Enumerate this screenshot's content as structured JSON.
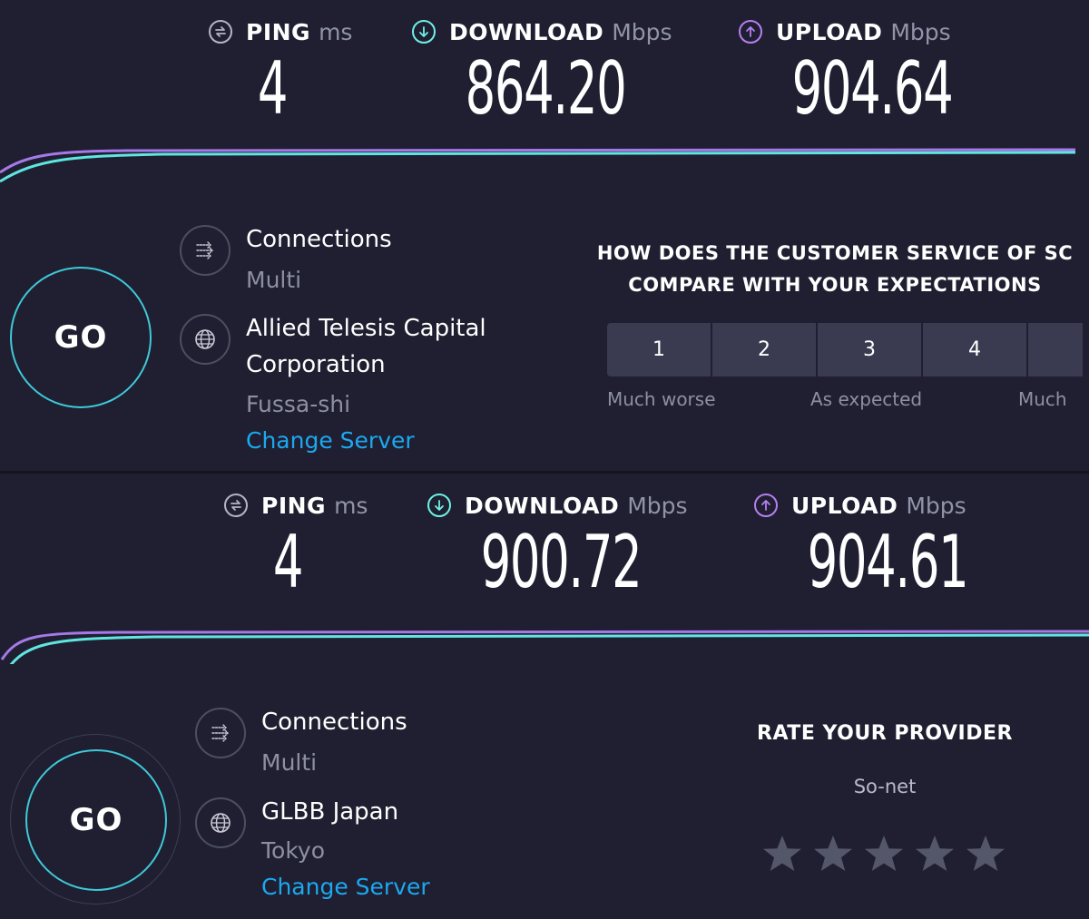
{
  "colors": {
    "background": "#1f1f31",
    "ping_icon": "#b4b4c4",
    "download_accent": "#6ff1e6",
    "upload_accent": "#b57ff0",
    "link": "#1ca8f0",
    "go_ring": "#3fc9d8"
  },
  "results": [
    {
      "ping": {
        "label": "PING",
        "unit": "ms",
        "value": "4",
        "icon": "ping-icon"
      },
      "download": {
        "label": "DOWNLOAD",
        "unit": "Mbps",
        "value": "864.20",
        "icon": "download-arrow-icon"
      },
      "upload": {
        "label": "UPLOAD",
        "unit": "Mbps",
        "value": "904.64",
        "icon": "upload-arrow-icon"
      },
      "go_label": "GO",
      "connections": {
        "title": "Connections",
        "value": "Multi",
        "icon": "connections-icon"
      },
      "server": {
        "title_line1": "Allied Telesis Capital",
        "title_line2": "Corporation",
        "location": "Fussa-shi",
        "icon": "globe-icon"
      },
      "change_server": "Change Server"
    },
    {
      "ping": {
        "label": "PING",
        "unit": "ms",
        "value": "4",
        "icon": "ping-icon"
      },
      "download": {
        "label": "DOWNLOAD",
        "unit": "Mbps",
        "value": "900.72",
        "icon": "download-arrow-icon"
      },
      "upload": {
        "label": "UPLOAD",
        "unit": "Mbps",
        "value": "904.61",
        "icon": "upload-arrow-icon"
      },
      "go_label": "GO",
      "connections": {
        "title": "Connections",
        "value": "Multi",
        "icon": "connections-icon"
      },
      "server": {
        "title_line1": "GLBB Japan",
        "location": "Tokyo",
        "icon": "globe-icon"
      },
      "change_server": "Change Server"
    }
  ],
  "survey": {
    "question_line1": "HOW DOES THE CUSTOMER SERVICE OF SC",
    "question_line2": "COMPARE WITH YOUR EXPECTATIONS",
    "options": [
      "1",
      "2",
      "3",
      "4",
      ""
    ],
    "caption_left": "Much worse",
    "caption_middle": "As expected",
    "caption_right": "Much"
  },
  "rating": {
    "title": "RATE YOUR PROVIDER",
    "provider": "So-net",
    "star_count": 5,
    "rating": 0
  }
}
